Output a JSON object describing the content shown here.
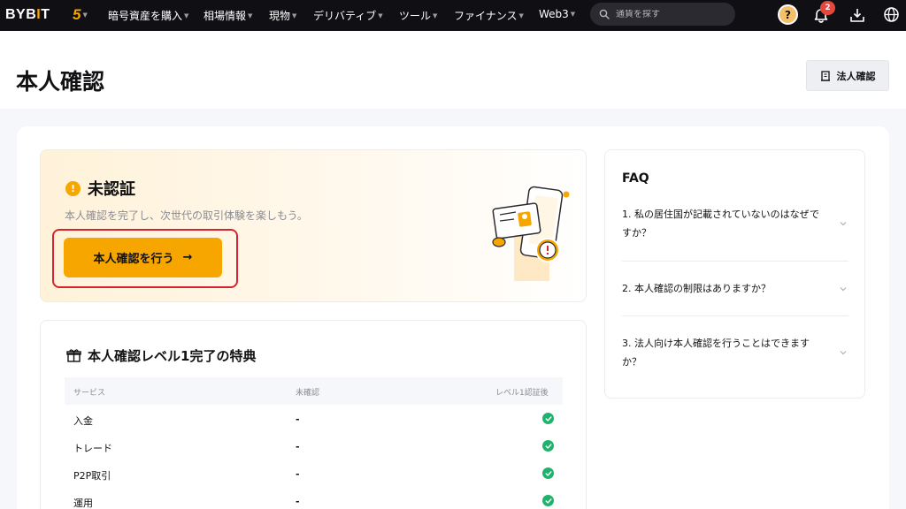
{
  "nav": {
    "logo_left": "BYB",
    "logo_accent": "I",
    "logo_right": "T",
    "five_label": "5",
    "items": [
      {
        "label": "暗号資産を購入"
      },
      {
        "label": "相場情報"
      },
      {
        "label": "現物"
      },
      {
        "label": "デリバティブ"
      },
      {
        "label": "ツール"
      },
      {
        "label": "ファイナンス"
      },
      {
        "label": "Web3"
      }
    ],
    "search_placeholder": "通貨を探す",
    "avatar_glyph": "?",
    "notification_count": "2",
    "icons": [
      "search-icon",
      "bell-icon",
      "download-icon",
      "globe-icon"
    ]
  },
  "header": {
    "title": "本人確認",
    "corp_button": "法人確認"
  },
  "unverified": {
    "status": "未認証",
    "description": "本人確認を完了し、次世代の取引体験を楽しもう。",
    "button_label": "本人確認を行う",
    "button_arrow": "→",
    "warn_glyph": "!"
  },
  "benefits": {
    "title": "本人確認レベル1完了の特典",
    "columns": [
      "サービス",
      "未確認",
      "レベル1認証後"
    ],
    "rows": [
      {
        "service": "入金",
        "before": "-",
        "after": "check"
      },
      {
        "service": "トレード",
        "before": "-",
        "after": "check"
      },
      {
        "service": "P2P取引",
        "before": "-",
        "after": "check"
      },
      {
        "service": "運用",
        "before": "-",
        "after": "check"
      }
    ]
  },
  "faq": {
    "title": "FAQ",
    "items": [
      {
        "question": "1. 私の居住国が記載されていないのはなぜですか？"
      },
      {
        "question": "2. 本人確認の制限はありますか？"
      },
      {
        "question": "3. 法人向け本人確認を行うことはできますか？"
      }
    ]
  },
  "colors": {
    "accent": "#f7a600",
    "nav_bg": "#101014",
    "highlight_outline": "#d5242f",
    "check": "#20b26c",
    "badge": "#e5463d"
  }
}
